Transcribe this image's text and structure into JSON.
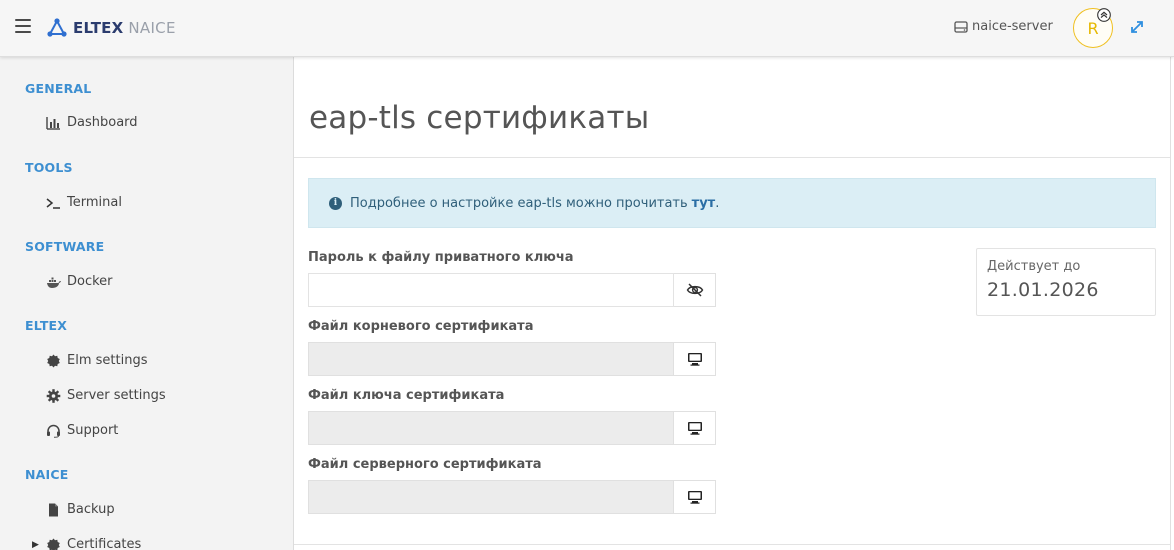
{
  "header": {
    "brand_primary": "ELTEX",
    "brand_secondary": "NAICE",
    "server_name": "naice-server",
    "avatar_letter": "R"
  },
  "sidebar": {
    "sections": [
      {
        "title": "GENERAL",
        "items": [
          {
            "label": "Dashboard",
            "icon": "bar-chart-icon"
          }
        ]
      },
      {
        "title": "TOOLS",
        "items": [
          {
            "label": "Terminal",
            "icon": "terminal-icon"
          }
        ]
      },
      {
        "title": "SOFTWARE",
        "items": [
          {
            "label": "Docker",
            "icon": "docker-icon"
          }
        ]
      },
      {
        "title": "ELTEX",
        "items": [
          {
            "label": "Elm settings",
            "icon": "badge-icon"
          },
          {
            "label": "Server settings",
            "icon": "gear-icon"
          },
          {
            "label": "Support",
            "icon": "headset-icon"
          }
        ]
      },
      {
        "title": "NAICE",
        "items": [
          {
            "label": "Backup",
            "icon": "file-icon"
          },
          {
            "label": "Certificates",
            "icon": "badge-icon"
          }
        ]
      }
    ]
  },
  "main": {
    "title": "eap-tls сертификаты",
    "info": {
      "text": "Подробнее о настройке eap-tls можно прочитать",
      "link": "тут",
      "suffix": "."
    },
    "fields": [
      {
        "label": "Пароль к файлу приватного ключа",
        "value": "",
        "button_icon": "eye-slash-icon"
      },
      {
        "label": "Файл корневого сертификата",
        "value": "",
        "button_icon": "monitor-icon"
      },
      {
        "label": "Файл ключа сертификата",
        "value": "",
        "button_icon": "monitor-icon"
      },
      {
        "label": "Файл серверного сертификата",
        "value": "",
        "button_icon": "monitor-icon"
      }
    ],
    "validity": {
      "label": "Действует до",
      "date": "21.01.2026"
    }
  },
  "colors": {
    "accent": "#3d8fd1",
    "brand_dark": "#2b3c6e",
    "info_bg": "#dbeef5",
    "avatar": "#f0c020"
  }
}
